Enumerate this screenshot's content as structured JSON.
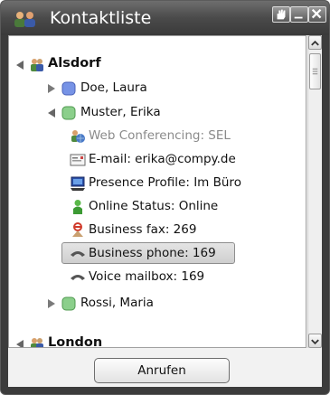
{
  "window": {
    "title": "Kontaktliste",
    "app_icon": "people-icon",
    "controls": [
      "hand-icon",
      "minimize-icon",
      "close-icon"
    ]
  },
  "tree": [
    {
      "label": "Alsdorf",
      "icon": "group-icon",
      "expanded": true,
      "bold": true
    },
    {
      "label": "Doe, Laura",
      "icon": "status-blue-icon",
      "expanded": false
    },
    {
      "label": "Muster, Erika",
      "icon": "status-green-icon",
      "expanded": true
    },
    {
      "label": "Web Conferencing: SEL",
      "icon": "web-conferencing-icon",
      "disabled": true
    },
    {
      "label": "E-mail: erika@compy.de",
      "icon": "email-icon"
    },
    {
      "label": "Presence Profile: Im Büro",
      "icon": "computer-icon"
    },
    {
      "label": "Online Status: Online",
      "icon": "person-online-icon"
    },
    {
      "label": "Business fax: 269",
      "icon": "fax-icon"
    },
    {
      "label": "Business phone: 169",
      "icon": "phone-icon",
      "selected": true
    },
    {
      "label": "Voice mailbox: 169",
      "icon": "voicemail-icon"
    },
    {
      "label": "Rossi, Maria",
      "icon": "status-green-icon",
      "expanded": false
    },
    {
      "label": "London",
      "icon": "group-icon",
      "expanded": true,
      "bold": true
    }
  ],
  "actions": {
    "call_label": "Anrufen"
  },
  "colors": {
    "blue_status": "#6f8fe0",
    "green_status": "#7ec27e",
    "selection": "#d8d8d8"
  }
}
